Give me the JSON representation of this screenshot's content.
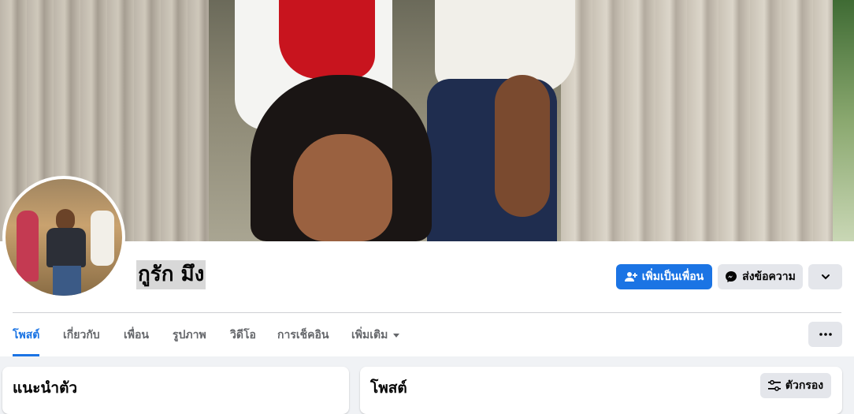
{
  "profile": {
    "name": "กูรัก มึง"
  },
  "actions": {
    "add_friend_label": "เพิ่มเป็นเพื่อน",
    "message_label": "ส่งข้อความ"
  },
  "tabs": [
    {
      "label": "โพสต์",
      "active": true
    },
    {
      "label": "เกี่ยวกับ",
      "active": false
    },
    {
      "label": "เพื่อน",
      "active": false
    },
    {
      "label": "รูปภาพ",
      "active": false
    },
    {
      "label": "วิดีโอ",
      "active": false
    },
    {
      "label": "การเช็คอิน",
      "active": false
    },
    {
      "label": "เพิ่มเติม",
      "active": false
    }
  ],
  "intro": {
    "title": "แนะนำตัว"
  },
  "posts": {
    "title": "โพสต์",
    "filter_label": "ตัวกรอง"
  },
  "colors": {
    "accent": "#1b74e4",
    "secondary_button": "#e4e6eb",
    "page_bg": "#f0f2f5"
  },
  "icons": {
    "add_friend": "add-person-icon",
    "message": "messenger-icon",
    "more": "chevron-down-icon",
    "tab_more": "caret-down-icon",
    "ellipsis": "ellipsis-icon",
    "filter": "filter-sliders-icon"
  }
}
